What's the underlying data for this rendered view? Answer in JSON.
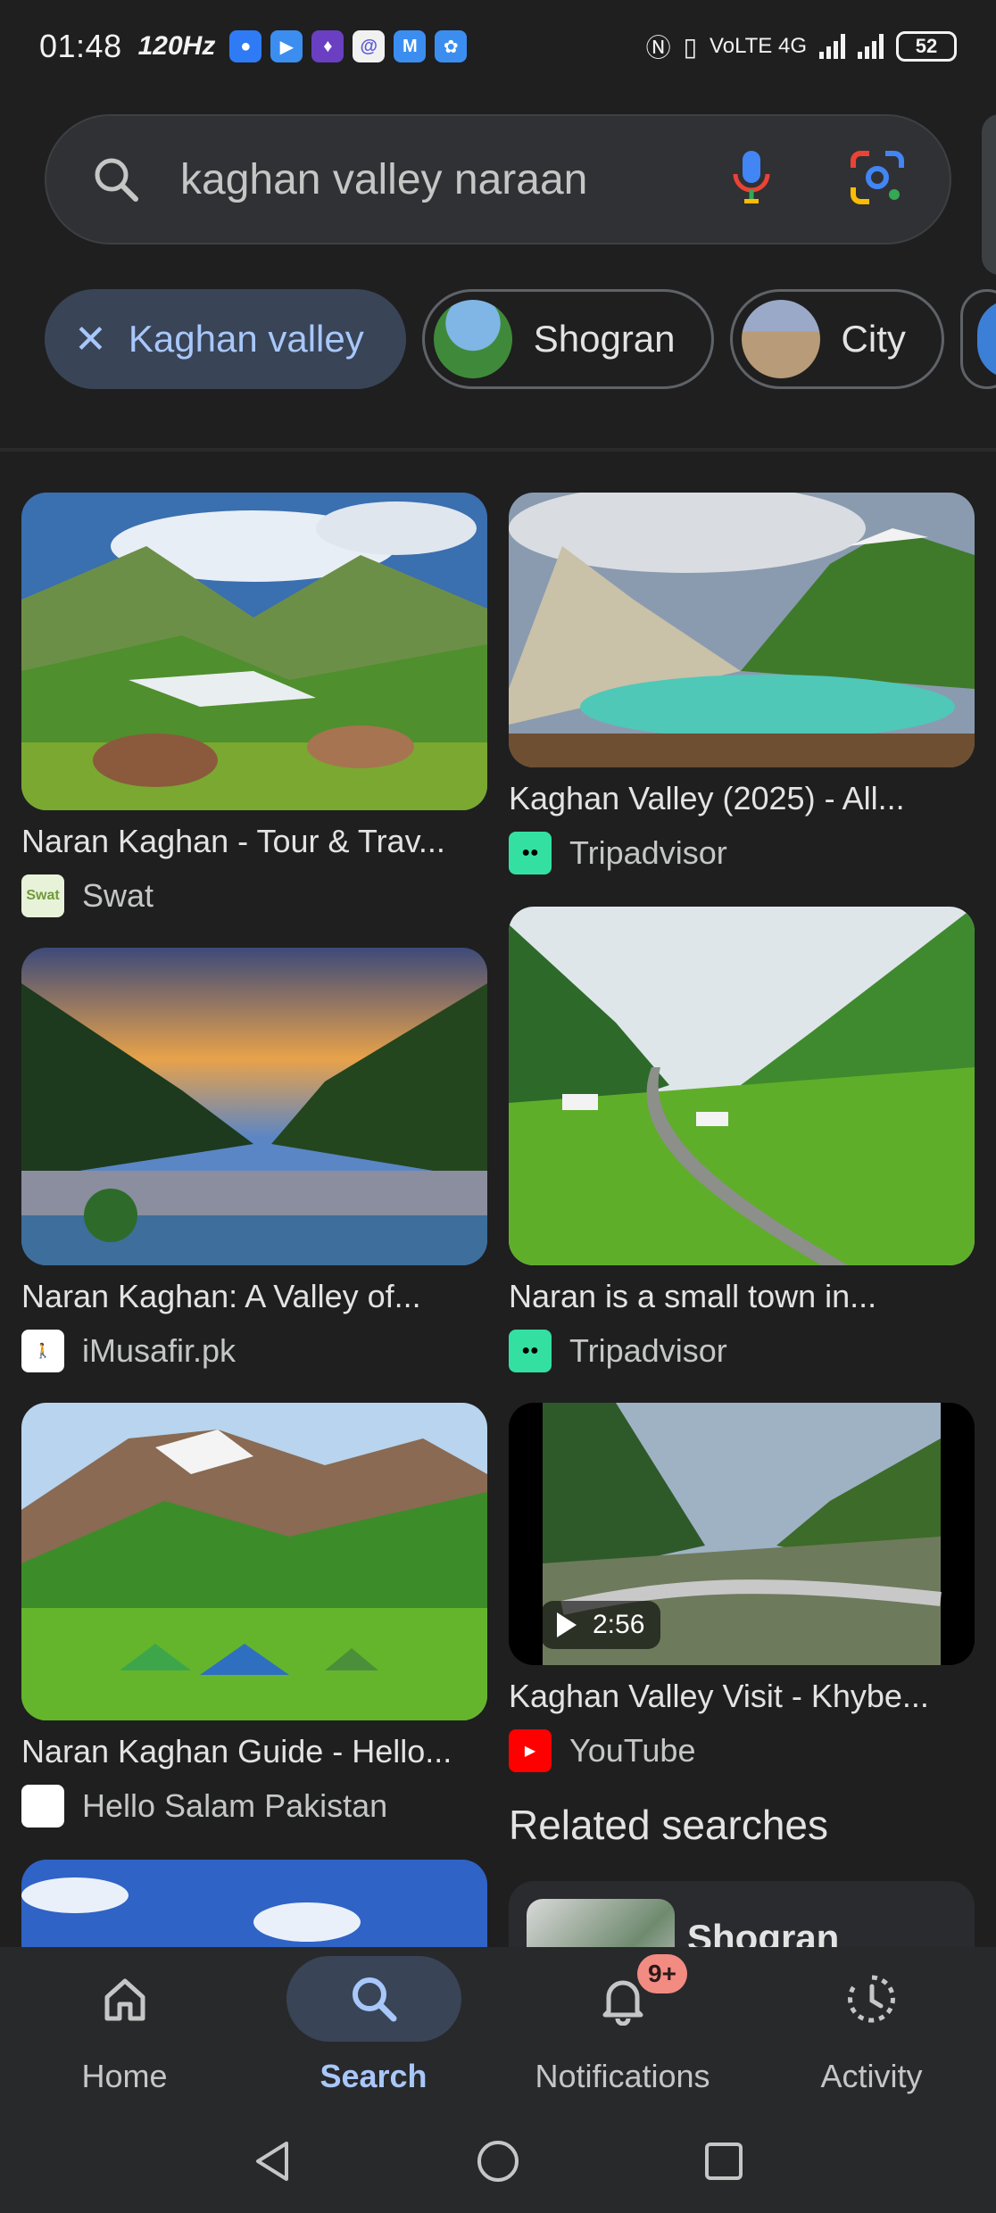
{
  "status_bar": {
    "time": "01:48",
    "refresh_rate": "120Hz",
    "network": "VoLTE 4G",
    "battery": "52"
  },
  "search": {
    "query": "kaghan valley naraan"
  },
  "chips": [
    {
      "label": "Kaghan valley",
      "selected": true
    },
    {
      "label": "Shogran",
      "selected": false
    },
    {
      "label": "City",
      "selected": false
    }
  ],
  "results": [
    {
      "title": "Naran Kaghan - Tour & Trav...",
      "source": "Swat",
      "favicon_text": "Swat"
    },
    {
      "title": "Kaghan Valley (2025) - All...",
      "source": "Tripadvisor"
    },
    {
      "title": "Naran Kaghan: A Valley of...",
      "source": "iMusafir.pk"
    },
    {
      "title": "Naran is a small town in...",
      "source": "Tripadvisor"
    },
    {
      "title": "Naran Kaghan Guide - Hello...",
      "source": "Hello Salam Pakistan"
    },
    {
      "title": "Kaghan Valley Visit - Khybe...",
      "source": "YouTube",
      "duration": "2:56"
    }
  ],
  "related": {
    "heading": "Related searches",
    "items": [
      {
        "label": "Shogran"
      }
    ]
  },
  "bottom_nav": [
    {
      "label": "Home",
      "icon": "home-icon"
    },
    {
      "label": "Search",
      "icon": "search-icon",
      "active": true
    },
    {
      "label": "Notifications",
      "icon": "bell-icon",
      "badge": "9+"
    },
    {
      "label": "Activity",
      "icon": "activity-icon"
    }
  ],
  "colors": {
    "background": "#1f1f1f",
    "accent": "#a8c7fa",
    "chip_selected": "#394457",
    "badge": "#f28b82"
  }
}
